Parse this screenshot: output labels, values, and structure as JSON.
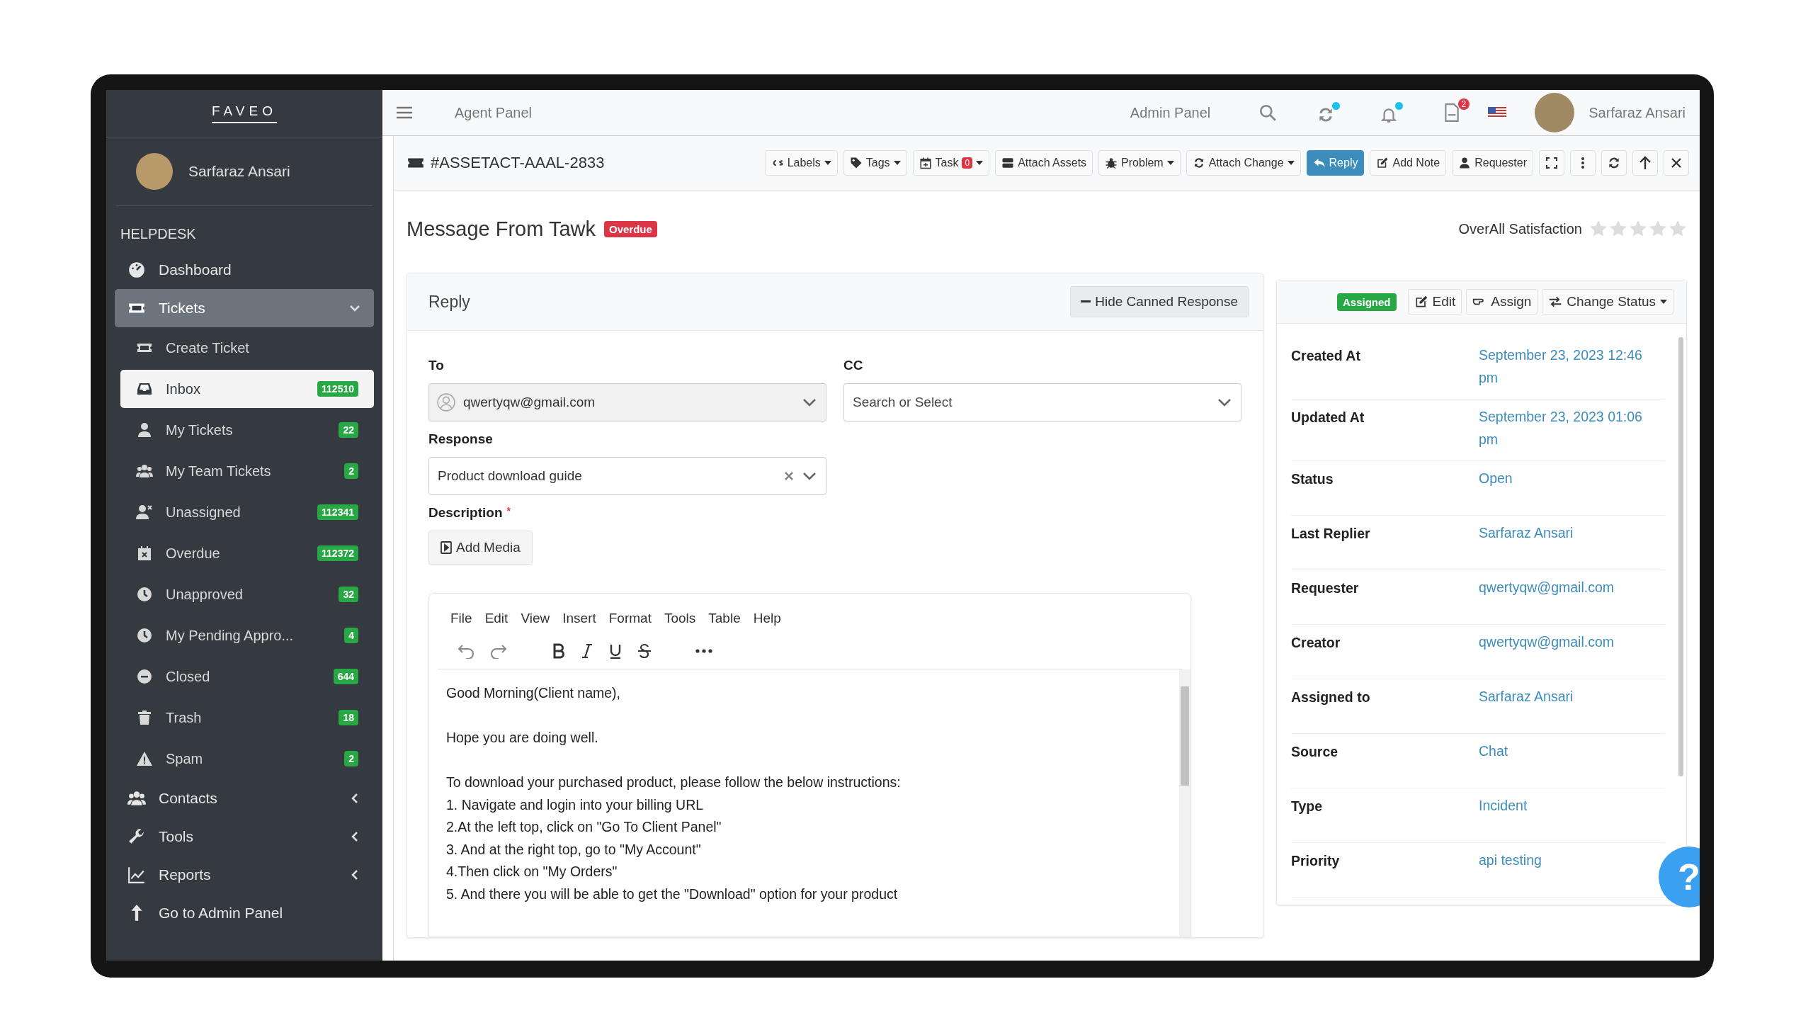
{
  "sidebar": {
    "logo": "FAVEO",
    "user": "Sarfaraz Ansari",
    "section": "HELPDESK",
    "items": [
      {
        "label": "Dashboard",
        "kind": "link",
        "selected": false
      },
      {
        "label": "Tickets",
        "kind": "group",
        "expanded": true,
        "selected": true,
        "children": [
          {
            "label": "Create Ticket",
            "selected": false
          },
          {
            "label": "Inbox",
            "count": "112510",
            "selected": true
          },
          {
            "label": "My Tickets",
            "count": "22",
            "selected": false
          },
          {
            "label": "My Team Tickets",
            "count": "2",
            "selected": false
          },
          {
            "label": "Unassigned",
            "count": "112341",
            "selected": false
          },
          {
            "label": "Overdue",
            "count": "112372",
            "selected": false
          },
          {
            "label": "Unapproved",
            "count": "32",
            "selected": false
          },
          {
            "label": "My Pending Appro...",
            "count": "4",
            "selected": false
          },
          {
            "label": "Closed",
            "count": "644",
            "selected": false
          },
          {
            "label": "Trash",
            "count": "18",
            "selected": false
          },
          {
            "label": "Spam",
            "count": "2",
            "selected": false
          }
        ]
      },
      {
        "label": "Contacts",
        "kind": "group",
        "expanded": false,
        "selected": false
      },
      {
        "label": "Tools",
        "kind": "group",
        "expanded": false,
        "selected": false
      },
      {
        "label": "Reports",
        "kind": "group",
        "expanded": false,
        "selected": false
      },
      {
        "label": "Go to Admin Panel",
        "kind": "link",
        "selected": false
      }
    ]
  },
  "topbar": {
    "title": "Agent Panel",
    "admin_link": "Admin Panel",
    "pdf_badge": "2",
    "user": "Sarfaraz Ansari"
  },
  "ticket": {
    "id": "#ASSETACT-AAAL-2833",
    "actions": [
      {
        "label": "Labels",
        "kind": "dropdown"
      },
      {
        "label": "Tags",
        "kind": "dropdown"
      },
      {
        "label": "Task",
        "kind": "dropdown",
        "badge": "0"
      },
      {
        "label": "Attach Assets",
        "kind": "button"
      },
      {
        "label": "Problem",
        "kind": "dropdown"
      },
      {
        "label": "Attach Change",
        "kind": "dropdown"
      },
      {
        "label": "Reply",
        "kind": "primary"
      },
      {
        "label": "Add Note",
        "kind": "button"
      },
      {
        "label": "Requester",
        "kind": "button"
      }
    ],
    "subject": "Message From Tawk",
    "status_badge": "Overdue"
  },
  "satisfaction": {
    "label": "OverAll Satisfaction",
    "stars": 0
  },
  "reply": {
    "title": "Reply",
    "hide_button": "Hide Canned Response",
    "to": {
      "label": "To",
      "value": "qwertyqw@gmail.com"
    },
    "cc": {
      "label": "CC",
      "placeholder": "Search or Select"
    },
    "response": {
      "label": "Response",
      "value": "Product download guide"
    },
    "description": {
      "label": "Description",
      "required_mark": "*"
    },
    "add_media": "Add Media",
    "editor_menu": [
      "File",
      "Edit",
      "View",
      "Insert",
      "Format",
      "Tools",
      "Table",
      "Help"
    ],
    "body": [
      [
        "Good Morning(Client name),"
      ],
      [
        "Hope you are doing well."
      ],
      [
        "To download your purchased product, please follow the below instructions:",
        "1. Navigate and login into your billing URL",
        "2.At the left top, click on \"Go To Client Panel\"",
        "3. And at the right top, go to \"My Account\"",
        "4.Then click on \"My Orders\"",
        "5. And there you will be able to get the \"Download\" option for your product"
      ]
    ]
  },
  "details": {
    "badge": "Assigned",
    "buttons": [
      "Edit",
      "Assign",
      "Change Status"
    ],
    "rows": [
      {
        "label": "Created At",
        "value": "September 23, 2023 12:46 pm"
      },
      {
        "label": "Updated At",
        "value": "September 23, 2023 01:06 pm"
      },
      {
        "label": "Status",
        "value": "Open"
      },
      {
        "label": "Last Replier",
        "value": "Sarfaraz Ansari"
      },
      {
        "label": "Requester",
        "value": "qwertyqw@gmail.com"
      },
      {
        "label": "Creator",
        "value": "qwertyqw@gmail.com"
      },
      {
        "label": "Assigned to",
        "value": "Sarfaraz Ansari"
      },
      {
        "label": "Source",
        "value": "Chat"
      },
      {
        "label": "Type",
        "value": "Incident"
      },
      {
        "label": "Priority",
        "value": "api testing"
      }
    ]
  },
  "help_button": "?"
}
